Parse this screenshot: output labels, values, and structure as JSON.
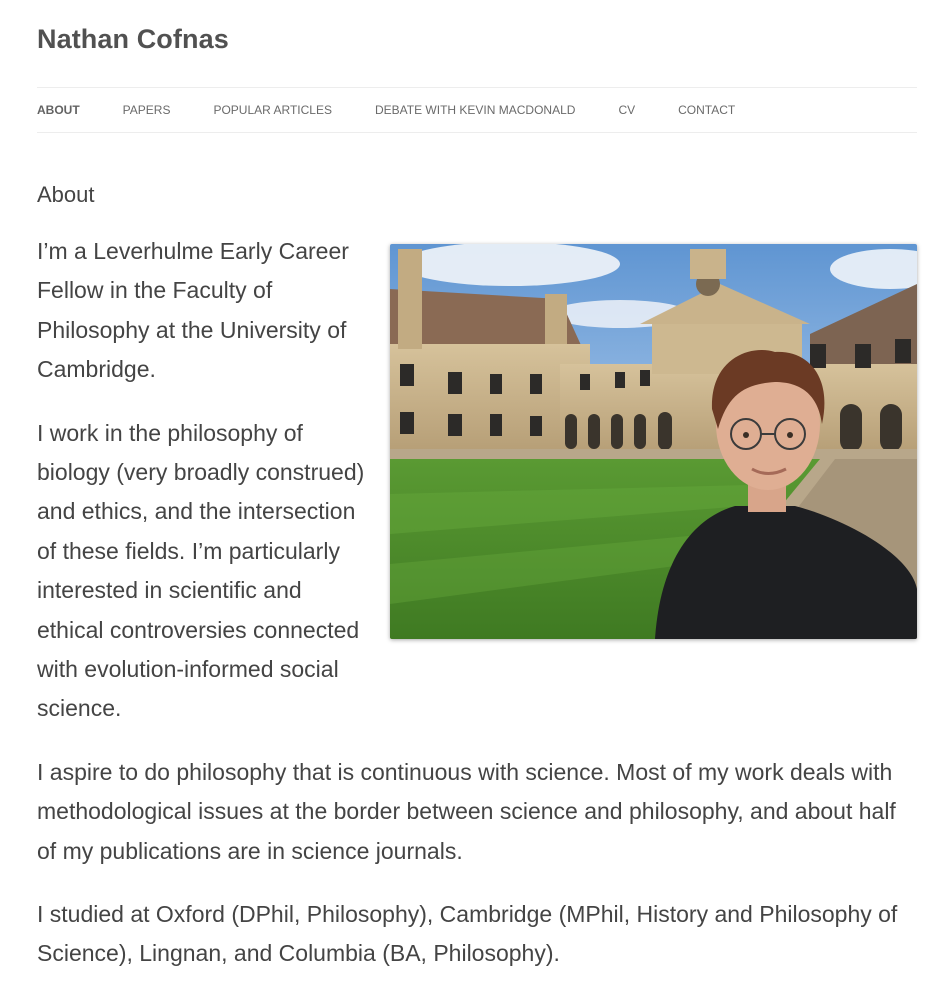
{
  "site": {
    "title": "Nathan Cofnas"
  },
  "nav": {
    "items": [
      {
        "label": "About",
        "active": true
      },
      {
        "label": "Papers",
        "active": false
      },
      {
        "label": "Popular Articles",
        "active": false
      },
      {
        "label": "Debate with Kevin MacDonald",
        "active": false
      },
      {
        "label": "CV",
        "active": false
      },
      {
        "label": "Contact",
        "active": false
      }
    ]
  },
  "page": {
    "heading": "About",
    "paragraphs": [
      "I’m a Leverhulme Early Career Fellow in the Faculty of Philosophy at the University of Cambridge.",
      "I work in the philosophy of biology (very broadly construed) and ethics, and the intersection of these fields. I’m particularly interested in scientific and ethical controversies connected with evolution-informed social science.",
      "I aspire to do philosophy that is continuous with science. Most of my work deals with methodological issues at the border between science and philosophy, and about half of my publications are in science journals.",
      "I studied at Oxford (DPhil, Philosophy), Cambridge (MPhil, History and Philosophy of Science), Lingnan, and Columbia (BA, Philosophy)."
    ]
  },
  "colors": {
    "text": "#444444",
    "title": "#515151",
    "nav_border": "#ededed",
    "lawn": "#4e8a2a",
    "stone": "#c7b28c",
    "sky": "#6b9fd6"
  }
}
